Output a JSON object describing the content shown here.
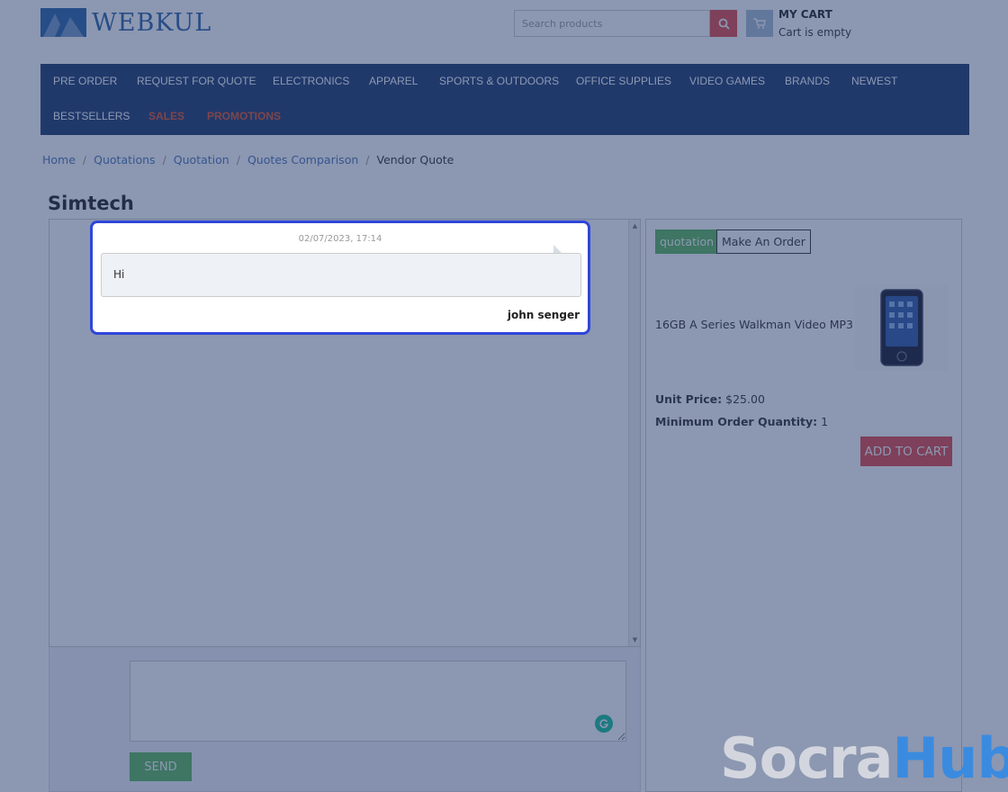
{
  "header": {
    "logo_text": "WEBKUL",
    "search_placeholder": "Search products",
    "cart_title": "MY CART",
    "cart_status": "Cart is empty"
  },
  "nav": {
    "items": [
      "PRE ORDER",
      "REQUEST FOR QUOTE",
      "ELECTRONICS",
      "APPAREL",
      "SPORTS & OUTDOORS",
      "OFFICE SUPPLIES",
      "VIDEO GAMES",
      "BRANDS",
      "NEWEST",
      "BESTSELLERS",
      "SALES",
      "PROMOTIONS"
    ]
  },
  "breadcrumb": [
    "Home",
    "Quotations",
    "Quotation",
    "Quotes Comparison",
    "Vendor Quote"
  ],
  "page": {
    "title": "Simtech"
  },
  "chat": {
    "message": {
      "timestamp": "02/07/2023, 17:14",
      "text": "Hi",
      "author": "john senger"
    },
    "send_label": "SEND"
  },
  "quote": {
    "tabs": [
      "quotation",
      "Make An Order"
    ],
    "product_name": "16GB A Series Walkman Video MP3",
    "unit_price_label": "Unit Price:",
    "unit_price": "$25.00",
    "moq_label": "Minimum Order Quantity:",
    "moq": "1",
    "add_to_cart": "ADD TO CART"
  },
  "watermark": {
    "part1": "Socra",
    "part2": "Hub"
  },
  "colors": {
    "nav_bg": "#1f3b6e",
    "brand_blue": "#2a65a8",
    "accent_red": "#e14a4a",
    "send_green": "#5cb85c",
    "highlight_border": "#2f46d9"
  }
}
